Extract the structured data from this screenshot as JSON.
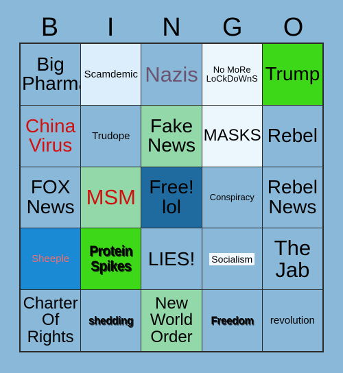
{
  "header": {
    "letters": [
      "B",
      "I",
      "N",
      "G",
      "O"
    ]
  },
  "colors": {
    "page_background": "#8ab8d9",
    "cell_blue": "#8ab8d9",
    "cell_light_blue": "#dceefb",
    "cell_pale_blue": "#ebf6fd",
    "cell_bright_green": "#3dd918",
    "cell_light_green": "#92d8a8",
    "cell_steel_blue": "#1f6ba0",
    "cell_bright_blue": "#1b8ad4",
    "text_black": "#000000",
    "text_red": "#d11010",
    "text_purple": "#6b5570",
    "text_salmon": "#f0706e",
    "grid_border": "#2b2b2b"
  },
  "grid": {
    "rows": [
      [
        {
          "label": "Big\nPharma",
          "bg": "#8ab8d9",
          "color": "#000000",
          "size": "s-lg",
          "style": ""
        },
        {
          "label": "Scamdemic",
          "bg": "#dceefb",
          "color": "#000000",
          "size": "s-sm",
          "style": ""
        },
        {
          "label": "Nazis",
          "bg": "#8ab8d9",
          "color": "#6b5570",
          "size": "s-xl",
          "style": ""
        },
        {
          "label": "No MoRe\nLoCkDoWnS",
          "bg": "#ebf6fd",
          "color": "#000000",
          "size": "s-xs",
          "style": ""
        },
        {
          "label": "Trump",
          "bg": "#3dd918",
          "color": "#000000",
          "size": "s-lg",
          "style": ""
        }
      ],
      [
        {
          "label": "China\nVirus",
          "bg": "#8ab8d9",
          "color": "#d11010",
          "size": "s-lg",
          "style": ""
        },
        {
          "label": "Trudope",
          "bg": "#8ab8d9",
          "color": "#000000",
          "size": "s-sm",
          "style": ""
        },
        {
          "label": "Fake\nNews",
          "bg": "#92d8a8",
          "color": "#000000",
          "size": "s-lg",
          "style": ""
        },
        {
          "label": "MASKS",
          "bg": "#ebf6fd",
          "color": "#000000",
          "size": "s-md",
          "style": ""
        },
        {
          "label": "Rebel",
          "bg": "#8ab8d9",
          "color": "#000000",
          "size": "s-lg",
          "style": ""
        }
      ],
      [
        {
          "label": "FOX\nNews",
          "bg": "#8ab8d9",
          "color": "#000000",
          "size": "s-lg",
          "style": ""
        },
        {
          "label": "MSM",
          "bg": "#92d8a8",
          "color": "#d11010",
          "size": "s-xl",
          "style": ""
        },
        {
          "label": "Free!\nlol",
          "bg": "#1f6ba0",
          "color": "#000000",
          "size": "s-lg",
          "style": ""
        },
        {
          "label": "Conspiracy",
          "bg": "#8ab8d9",
          "color": "#000000",
          "size": "s-xs",
          "style": ""
        },
        {
          "label": "Rebel\nNews",
          "bg": "#8ab8d9",
          "color": "#000000",
          "size": "s-lg",
          "style": ""
        }
      ],
      [
        {
          "label": "Sheeple",
          "bg": "#1b8ad4",
          "color": "#f0706e",
          "size": "s-sm",
          "style": ""
        },
        {
          "label": "Protein\nSpikes",
          "bg": "#3dd918",
          "color": "#000000",
          "size": "",
          "style": "w-bold"
        },
        {
          "label": "LIES!",
          "bg": "#8ab8d9",
          "color": "#000000",
          "size": "s-lg",
          "style": ""
        },
        {
          "label": "Socialism",
          "bg": "#8ab8d9",
          "color": "#000000",
          "size": "",
          "style": "hl"
        },
        {
          "label": "The\nJab",
          "bg": "#8ab8d9",
          "color": "#000000",
          "size": "s-xl",
          "style": ""
        }
      ],
      [
        {
          "label": "Charter\nOf\nRights",
          "bg": "#8ab8d9",
          "color": "#000000",
          "size": "s-md",
          "style": ""
        },
        {
          "label": "shedding",
          "bg": "#8ab8d9",
          "color": "#000000",
          "size": "",
          "style": "w-bold-sm"
        },
        {
          "label": "New\nWorld\nOrder",
          "bg": "#92d8a8",
          "color": "#000000",
          "size": "s-md",
          "style": ""
        },
        {
          "label": "Freedom",
          "bg": "#8ab8d9",
          "color": "#000000",
          "size": "",
          "style": "w-bold-sm"
        },
        {
          "label": "revolution",
          "bg": "#8ab8d9",
          "color": "#000000",
          "size": "s-sm",
          "style": ""
        }
      ]
    ]
  }
}
